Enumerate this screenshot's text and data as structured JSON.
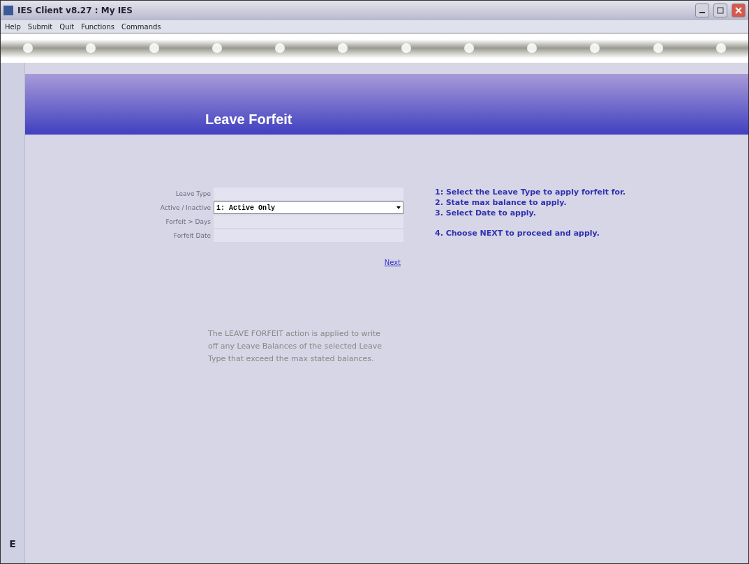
{
  "window": {
    "title": "IES Client v8.27 : My IES"
  },
  "menu": [
    "Help",
    "Submit",
    "Quit",
    "Functions",
    "Commands"
  ],
  "page": {
    "title": "Leave Forfeit"
  },
  "form": {
    "fields": [
      {
        "label": "Leave Type",
        "kind": "text"
      },
      {
        "label": "Active / Inactive",
        "kind": "select",
        "value": "1: Active Only"
      },
      {
        "label": "Forfeit > Days",
        "kind": "text"
      },
      {
        "label": "Forfeit Date",
        "kind": "text"
      }
    ],
    "next_link": "Next"
  },
  "instructions": [
    "1: Select the Leave Type to apply forfeit for.",
    "2. State max balance to apply.",
    "3. Select Date to apply.",
    "4. Choose NEXT to proceed and apply."
  ],
  "description": "The LEAVE FORFEIT action is applied to write off any Leave Balances of the selected Leave Type that exceed the max stated balances.",
  "side_glyph": "E"
}
